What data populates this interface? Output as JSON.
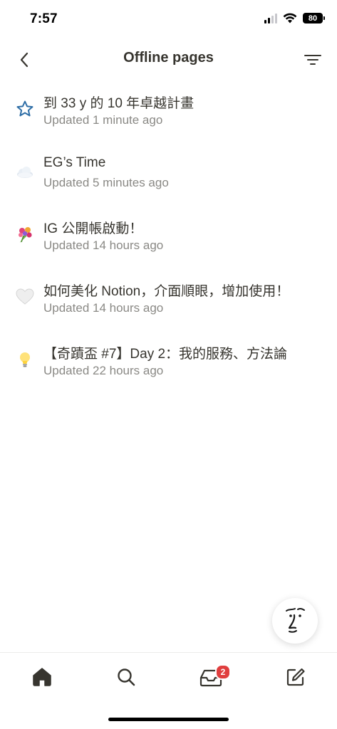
{
  "status_bar": {
    "time": "7:57",
    "battery": "80"
  },
  "header": {
    "title": "Offline pages",
    "back_icon": "chevron-left-icon",
    "filter_icon": "filter-icon"
  },
  "pages": [
    {
      "icon": "star-outline-icon",
      "title": "到 33 y 的 10 年卓越計畫",
      "updated": "Updated 1 minute ago"
    },
    {
      "icon": "cloud-emoji-icon",
      "title": "EG’s Time",
      "updated": "Updated 5 minutes ago"
    },
    {
      "icon": "bouquet-emoji-icon",
      "title": "IG 公開帳啟動！",
      "updated": "Updated 14 hours ago"
    },
    {
      "icon": "white-heart-emoji-icon",
      "title": "如何美化 Notion，介面順眼，增加使用！",
      "updated": "Updated 14 hours ago"
    },
    {
      "icon": "lightbulb-emoji-icon",
      "title": "【奇蹟盃 #7】Day 2：我的服務、方法論",
      "updated": "Updated 22 hours ago"
    }
  ],
  "tabbar": {
    "home_icon": "home-icon",
    "search_icon": "search-icon",
    "inbox_icon": "inbox-icon",
    "inbox_badge": "2",
    "compose_icon": "compose-icon"
  },
  "colors": {
    "text": "#37352f",
    "secondary": "#8a8985",
    "badge": "#e03e3e",
    "star": "#2e6ea6"
  }
}
